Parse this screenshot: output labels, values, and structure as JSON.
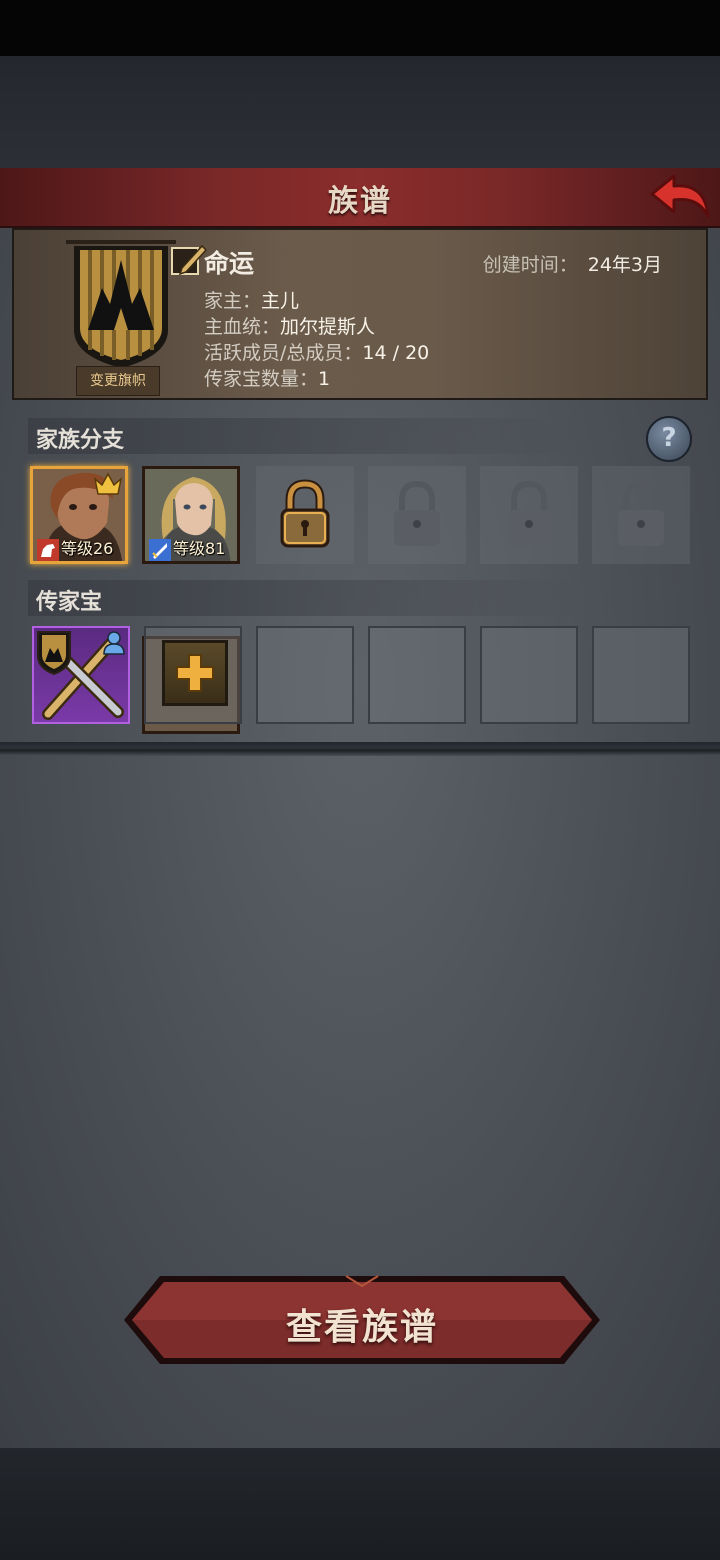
{
  "header": {
    "title": "族谱"
  },
  "clan": {
    "change_banner_label": "变更旗帜",
    "name": "命运",
    "created_label": "创建时间：",
    "created_value": "24年3月",
    "info": [
      {
        "label": "家主：",
        "value": "主儿"
      },
      {
        "label": "主血统：",
        "value": "加尔提斯人"
      },
      {
        "label": "活跃成员/总成员：",
        "value": "14 / 20"
      },
      {
        "label": "传家宝数量：",
        "value": "1"
      }
    ]
  },
  "branches": {
    "title": "家族分支",
    "help_icon": "question-icon",
    "members": [
      {
        "level": "等级26",
        "leader": true,
        "class_icon": "horse-icon",
        "class_color": "#c0392b"
      },
      {
        "level": "等级81",
        "leader": false,
        "class_icon": "sword-icon",
        "class_color": "#3b6fd1"
      }
    ],
    "slots": [
      "unlockable",
      "locked",
      "locked",
      "locked"
    ]
  },
  "heirlooms": {
    "title": "传家宝",
    "items": [
      {
        "icon": "crossed-swords-icon",
        "rarity_color": "#b060e0",
        "equipped_by_icon": "person-icon"
      }
    ],
    "add_icon": "plus-icon",
    "empty_slots": 4
  },
  "actions": {
    "view_tree_label": "查看族谱"
  },
  "colors": {
    "accent": "#8a2d2c",
    "gold": "#e6a43a",
    "purple": "#b060e0"
  }
}
